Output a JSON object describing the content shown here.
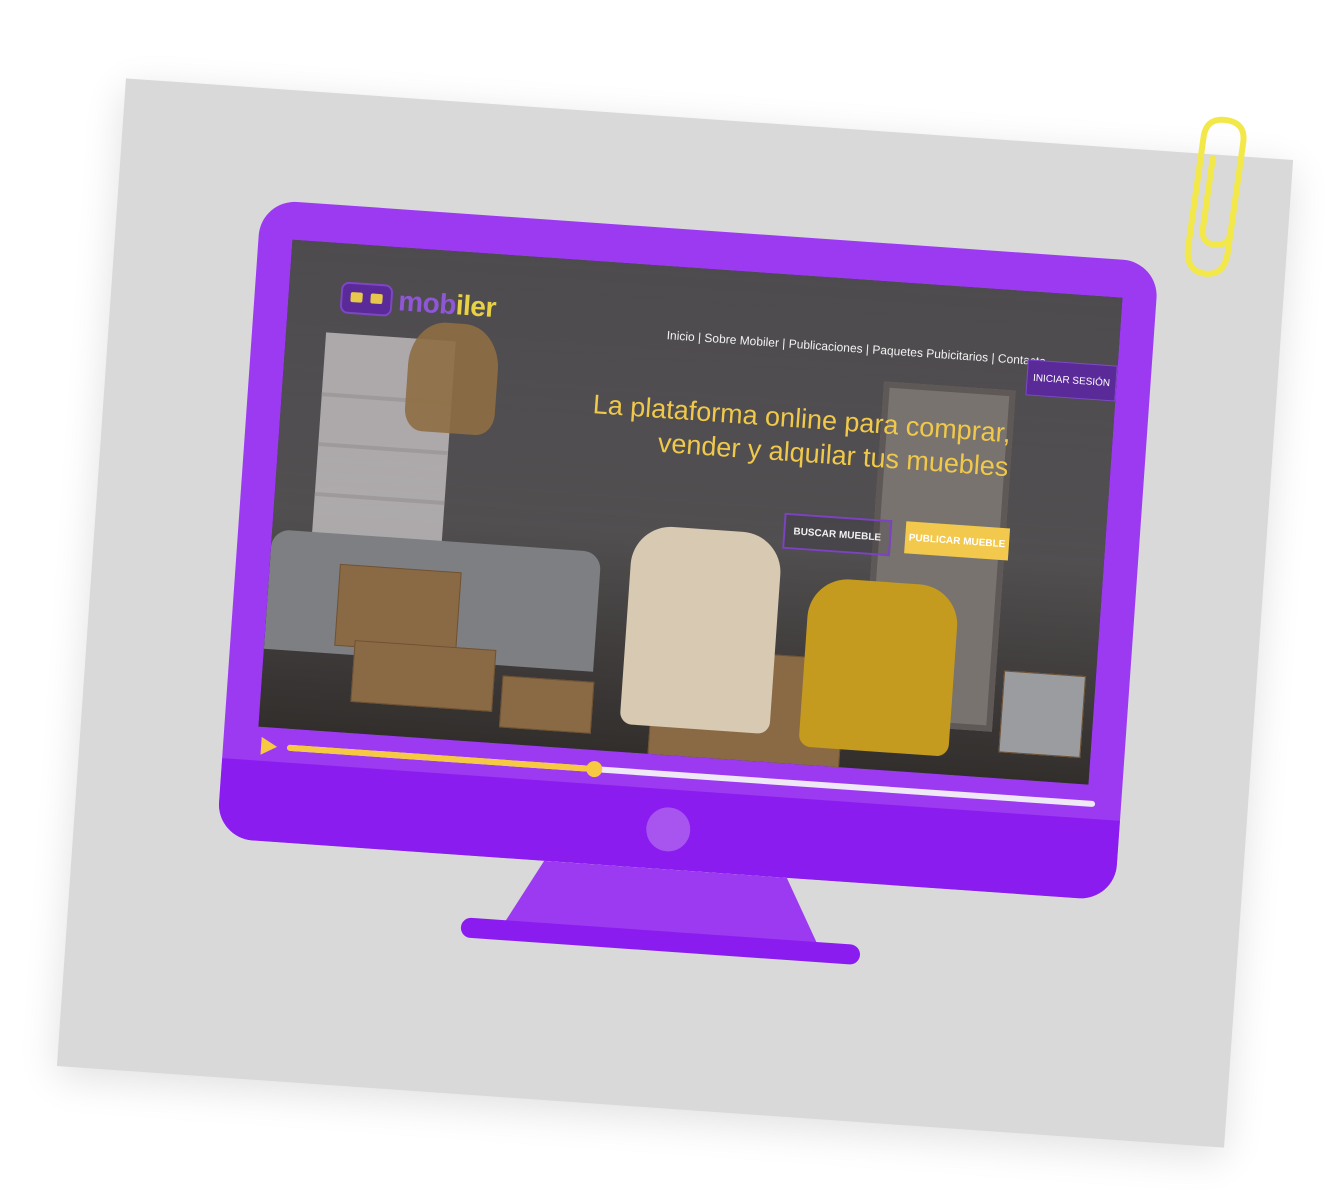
{
  "brand": {
    "name_part1": "mob",
    "name_part2": "iler"
  },
  "nav": {
    "items": [
      "Inicio",
      "Sobre Mobiler",
      "Publicaciones",
      "Paquetes Pubicitarios",
      "Contacto"
    ],
    "login_label": "INICIAR SESIÓN"
  },
  "hero": {
    "headline_line1": "La plataforma online para comprar,",
    "headline_line2": "vender y alquilar tus muebles",
    "search_button": "BUSCAR MUEBLE",
    "publish_button": "PUBLICAR MUEBLE"
  },
  "video": {
    "progress": 0.38
  },
  "colors": {
    "monitor": "#9b3af0",
    "accent_yellow": "#f7c942",
    "brand_purple": "#5a2a98"
  },
  "icons": [
    "paperclip-icon",
    "play-icon",
    "logo-sofa-icon"
  ]
}
